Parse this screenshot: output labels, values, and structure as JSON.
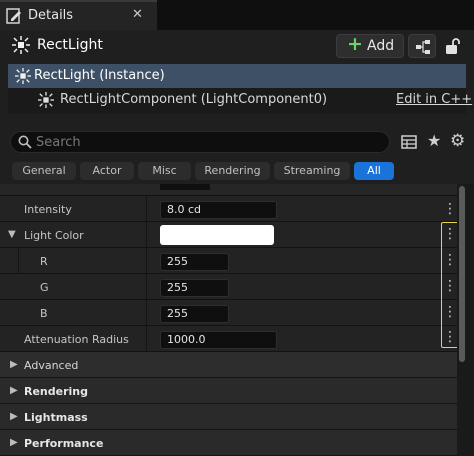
{
  "tab": {
    "title": "Details",
    "close": "✕"
  },
  "header": {
    "actor_name": "RectLight",
    "add_label": "Add",
    "add_plus": "+"
  },
  "tree": {
    "instance_label": "RectLight (Instance)",
    "component_label": "RectLightComponent (LightComponent0)",
    "edit_link": "Edit in C++"
  },
  "search": {
    "placeholder": "Search"
  },
  "filters": [
    "General",
    "Actor",
    "Misc",
    "Rendering",
    "Streaming",
    "All"
  ],
  "properties": {
    "intensity": {
      "label": "Intensity",
      "value": "8.0 cd"
    },
    "light_color": {
      "label": "Light Color",
      "color": "#ffffff"
    },
    "r": {
      "label": "R",
      "value": "255"
    },
    "g": {
      "label": "G",
      "value": "255"
    },
    "b": {
      "label": "B",
      "value": "255"
    },
    "attenuation": {
      "label": "Attenuation Radius",
      "value": "1000.0"
    }
  },
  "sections": {
    "advanced": "Advanced",
    "rendering": "Rendering",
    "lightmass": "Lightmass",
    "performance": "Performance"
  },
  "glyphs": {
    "more": "⋮",
    "collapsed": "▶",
    "expanded": "▼",
    "star": "★",
    "gear": "⚙"
  },
  "colors": {
    "accent": "#1a73d9",
    "selection": "#3e5066",
    "highlight": "#e8d44d",
    "add_plus": "#6bd16b"
  }
}
